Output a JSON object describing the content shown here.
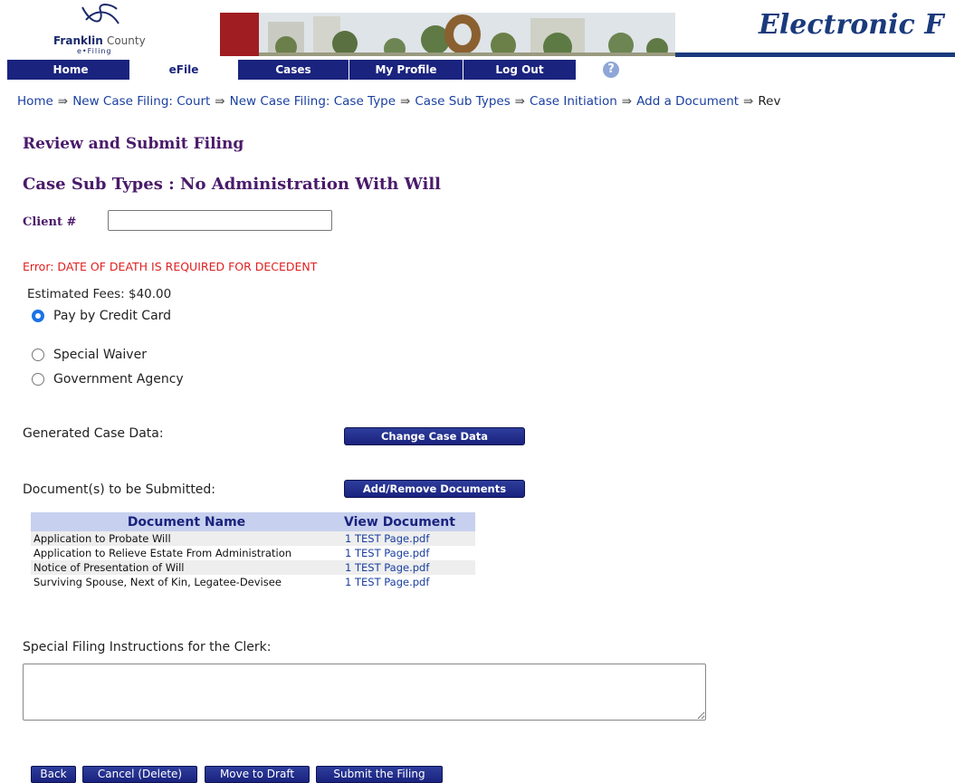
{
  "header": {
    "logo_name": "Franklin",
    "logo_county": "County",
    "logo_efiling": "e•Filing",
    "title": "Electronic F"
  },
  "nav": {
    "tabs": [
      {
        "label": "Home"
      },
      {
        "label": "eFile",
        "active": true
      },
      {
        "label": "Cases"
      },
      {
        "label": "My Profile"
      },
      {
        "label": "Log Out"
      }
    ],
    "help_icon": "?"
  },
  "breadcrumb": {
    "items": [
      "Home",
      "New Case Filing: Court",
      "New Case Filing: Case Type",
      "Case Sub Types",
      "Case Initiation",
      "Add a Document",
      "Rev"
    ],
    "separator": "⇛"
  },
  "page": {
    "title": "Review and Submit Filing",
    "subtype_title": "Case Sub Types : No Administration With Will"
  },
  "client": {
    "label": "Client #",
    "value": ""
  },
  "error": "Error: DATE OF DEATH IS REQUIRED FOR DECEDENT",
  "fees": {
    "label": "Estimated Fees: $40.00"
  },
  "payment_options": [
    {
      "label": "Pay by Credit Card",
      "checked": true
    },
    {
      "label": "Special Waiver",
      "checked": false
    },
    {
      "label": "Government Agency",
      "checked": false
    }
  ],
  "case_data": {
    "label": "Generated Case Data:",
    "button": "Change Case Data"
  },
  "documents": {
    "label": "Document(s) to be Submitted:",
    "button": "Add/Remove Documents",
    "headers": [
      "Document Name",
      "View Document"
    ],
    "rows": [
      {
        "name": "Application to Probate Will",
        "file": "1 TEST Page.pdf"
      },
      {
        "name": "Application to Relieve Estate From Administration",
        "file": "1 TEST Page.pdf"
      },
      {
        "name": "Notice of Presentation of Will",
        "file": "1 TEST Page.pdf"
      },
      {
        "name": "Surviving Spouse, Next of Kin, Legatee-Devisee",
        "file": "1 TEST Page.pdf"
      }
    ]
  },
  "instructions": {
    "label": "Special Filing Instructions for the Clerk:",
    "value": ""
  },
  "actions": {
    "back": "Back",
    "cancel": "Cancel (Delete)",
    "draft": "Move to Draft",
    "submit": "Submit the Filing"
  },
  "colors": {
    "nav_blue": "#1a237e",
    "heading_purple": "#4a1a6a",
    "link_blue": "#1a3fa0",
    "error_red": "#e02020",
    "banner_red": "#a01d22"
  }
}
